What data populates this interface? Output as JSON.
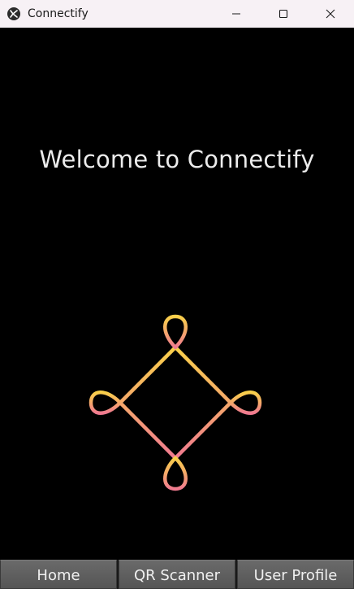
{
  "window": {
    "title": "Connectify"
  },
  "main": {
    "welcome_text": "Welcome to Connectify",
    "logo_icon": "infinity-diamond-logo-icon",
    "logo_gradient": [
      "#f9d04a",
      "#f5a86a",
      "#f07a90"
    ]
  },
  "nav": {
    "items": [
      {
        "label": "Home"
      },
      {
        "label": "QR Scanner"
      },
      {
        "label": "User Profile"
      }
    ]
  },
  "colors": {
    "background": "#000000",
    "titlebar": "#f7f1f5",
    "text": "#ececec",
    "nav_button": "#5e5e5e"
  }
}
